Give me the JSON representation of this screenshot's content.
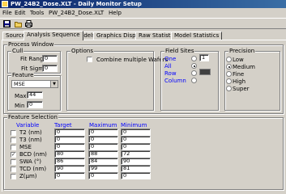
{
  "window": {
    "title": "PW_24B2_Dose.XLT - Daily Monitor Setup"
  },
  "menu": [
    "File",
    "Edit",
    "Tools",
    "PW_24B2_Dose.XLT",
    "Help"
  ],
  "toolbar": {
    "icons": [
      "save-icon",
      "open-folder-icon",
      "print-icon"
    ]
  },
  "tabs": [
    "Source",
    "Analysis Sequence",
    "Models",
    "Graphics Display",
    "Raw Statistics",
    "Model Statistics"
  ],
  "active_tab": "Analysis Sequence",
  "process_window": {
    "title": "Process Window",
    "cull": {
      "title": "Cull",
      "fit_range_label": "Fit Range",
      "fit_range_value": "0",
      "fit_sigma_label": "Fit Sigma",
      "fit_sigma_value": "0"
    },
    "feature": {
      "title": "Feature",
      "selected": "MSE",
      "max_label": "Max",
      "max_value": "44",
      "min_label": "Min",
      "min_value": "0"
    },
    "options": {
      "title": "Options",
      "combine_label": "Combine multiple Wafers",
      "combine_checked": false
    },
    "field_sites": {
      "title": "Field Sites",
      "items": [
        {
          "label": "One",
          "selected": false
        },
        {
          "label": "All",
          "selected": true
        },
        {
          "label": "Row",
          "selected": false
        },
        {
          "label": "Column",
          "selected": false
        }
      ],
      "one_value": "1"
    },
    "precision": {
      "title": "Precision",
      "items": [
        {
          "label": "Low",
          "selected": false
        },
        {
          "label": "Medium",
          "selected": true
        },
        {
          "label": "Fine",
          "selected": false
        },
        {
          "label": "High",
          "selected": false
        },
        {
          "label": "Super",
          "selected": false
        }
      ]
    }
  },
  "feature_selection": {
    "title": "Feature Selection",
    "headers": {
      "variable": "Variable",
      "target": "Target",
      "maximum": "Maximum",
      "minimum": "Minimum"
    },
    "rows": [
      {
        "name": "T2 (nm)",
        "checked": false,
        "target": "0",
        "maximum": "0",
        "minimum": "0"
      },
      {
        "name": "T3 (nm)",
        "checked": false,
        "target": "0",
        "maximum": "0",
        "minimum": "0"
      },
      {
        "name": "MSE",
        "checked": false,
        "target": "0",
        "maximum": "0",
        "minimum": "0"
      },
      {
        "name": "BCD (nm)",
        "checked": true,
        "target": "80",
        "maximum": "88",
        "minimum": "72"
      },
      {
        "name": "SWA (°)",
        "checked": false,
        "target": "86",
        "maximum": "84",
        "minimum": "90"
      },
      {
        "name": "TCD (nm)",
        "checked": false,
        "target": "90",
        "maximum": "99",
        "minimum": "81"
      },
      {
        "name": "Z(µm)",
        "checked": false,
        "target": "0",
        "maximum": "0",
        "minimum": "0"
      }
    ]
  }
}
